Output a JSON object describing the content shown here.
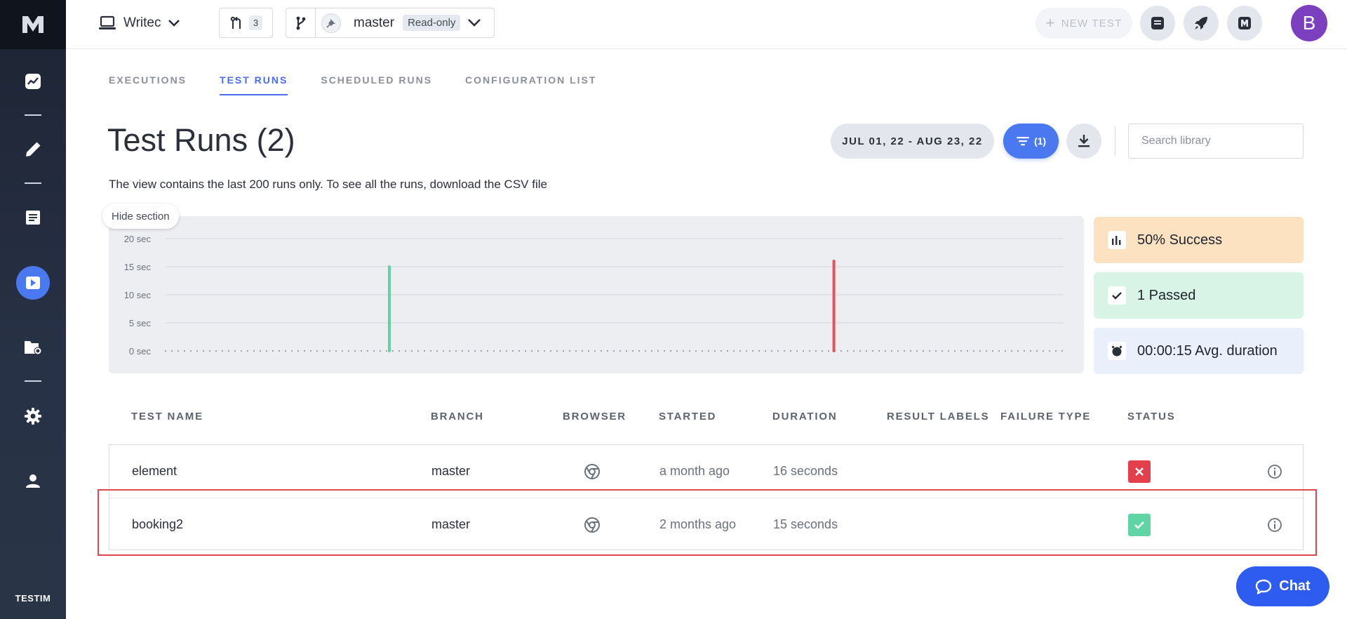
{
  "sidebar": {
    "brand": "TESTIM",
    "items": [
      {
        "icon": "dashboard-chart-icon"
      },
      {
        "icon": "pencil-icon"
      },
      {
        "icon": "document-icon"
      },
      {
        "icon": "play-icon",
        "active": true
      },
      {
        "icon": "folder-settings-icon"
      },
      {
        "icon": "gear-icon"
      },
      {
        "icon": "user-icon"
      }
    ]
  },
  "topbar": {
    "project_name": "Writec",
    "pr_count": "3",
    "branch_name": "master",
    "branch_badge": "Read-only",
    "new_test_label": "NEW TEST",
    "avatar_letter": "B"
  },
  "tabs": [
    {
      "label": "EXECUTIONS",
      "active": false
    },
    {
      "label": "TEST RUNS",
      "active": true
    },
    {
      "label": "SCHEDULED RUNS",
      "active": false
    },
    {
      "label": "CONFIGURATION LIST",
      "active": false
    }
  ],
  "page": {
    "title": "Test Runs (2)",
    "note": "The view contains the last 200 runs only. To see all the runs, download the CSV file",
    "date_range": "JUL 01, 22 - AUG 23, 22",
    "filter_count": "(1)",
    "search_placeholder": "Search library",
    "hide_section_label": "Hide section"
  },
  "chart_data": {
    "type": "bar",
    "y_tick_labels": [
      "20 sec",
      "15 sec",
      "10 sec",
      "5 sec",
      "0 sec"
    ],
    "ylim": [
      0,
      20
    ],
    "grid": true,
    "runs": [
      {
        "x_fraction": 0.25,
        "value": 15,
        "status": "passed",
        "color": "#5fd4a4"
      },
      {
        "x_fraction": 0.745,
        "value": 16,
        "status": "failed",
        "color": "#ee4f5a"
      }
    ]
  },
  "stats": [
    {
      "text": "50% Success",
      "icon": "bar-chart-icon",
      "bg": "#fde2c2"
    },
    {
      "text": "1 Passed",
      "icon": "check-icon",
      "bg": "#d8f4e6"
    },
    {
      "text": "00:00:15 Avg. duration",
      "icon": "stopwatch-icon",
      "bg": "#eaf0fb"
    }
  ],
  "table": {
    "headers": [
      "TEST NAME",
      "BRANCH",
      "BROWSER",
      "STARTED",
      "DURATION",
      "RESULT LABELS",
      "FAILURE TYPE",
      "STATUS"
    ],
    "rows": [
      {
        "name": "element",
        "branch": "master",
        "browser": "chrome-icon",
        "started": "a month ago",
        "duration": "16 seconds",
        "result_labels": "",
        "failure_type": "",
        "status": "failed"
      },
      {
        "name": "booking2",
        "branch": "master",
        "browser": "chrome-icon",
        "started": "2 months ago",
        "duration": "15 seconds",
        "result_labels": "",
        "failure_type": "",
        "status": "passed"
      }
    ]
  },
  "colors": {
    "accent": "#4a78f0",
    "failed": "#e4404b",
    "passed": "#5fd4a4",
    "highlight": "#e2474d"
  },
  "chat": {
    "label": "Chat"
  }
}
